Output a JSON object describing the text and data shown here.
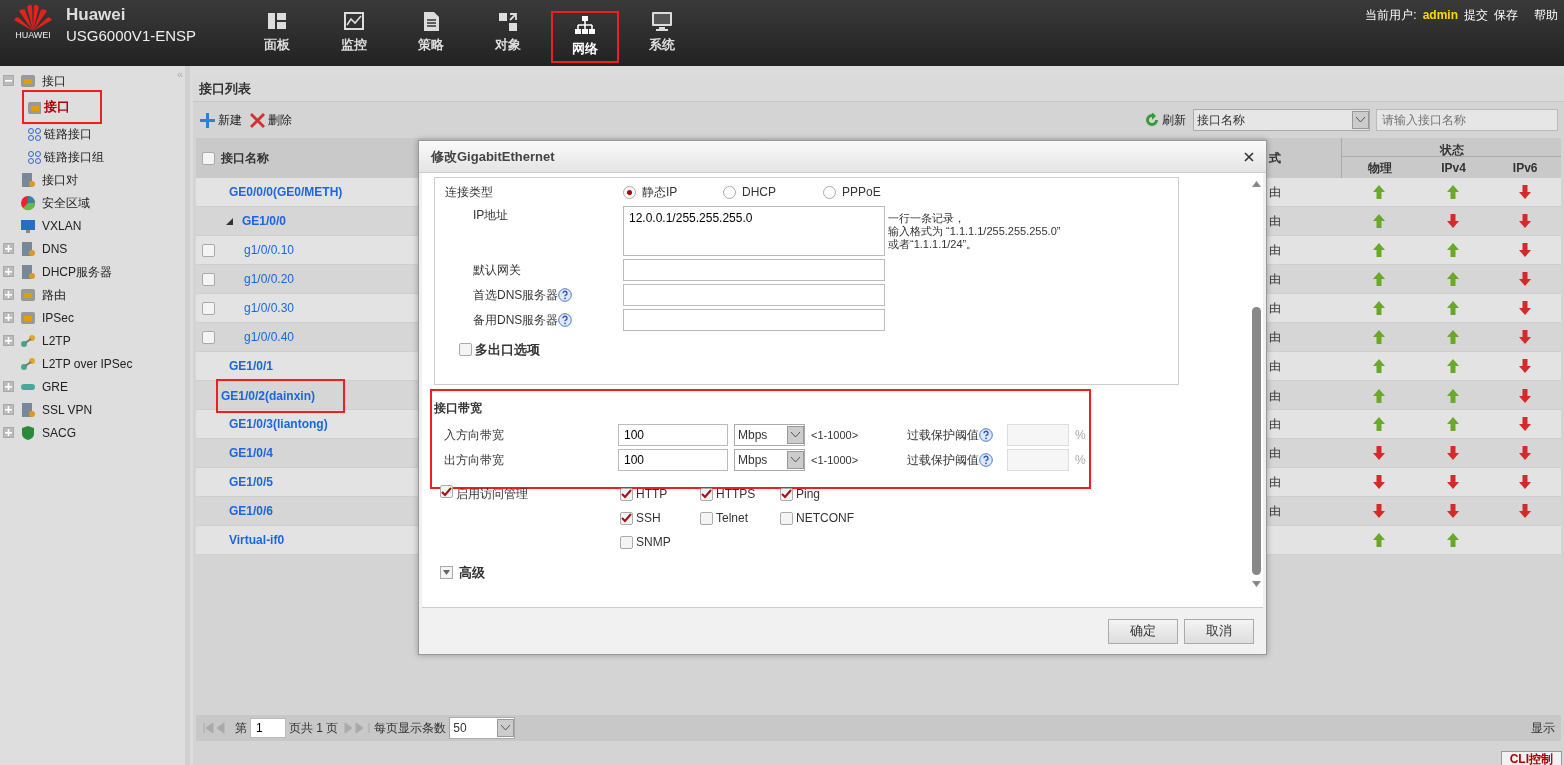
{
  "brand": {
    "company": "Huawei",
    "logo_text": "HUAWEI",
    "model": "USG6000V1-ENSP"
  },
  "nav": [
    {
      "label": "面板",
      "selected": false,
      "highlighted": false
    },
    {
      "label": "监控",
      "selected": false,
      "highlighted": false
    },
    {
      "label": "策略",
      "selected": false,
      "highlighted": false
    },
    {
      "label": "对象",
      "selected": false,
      "highlighted": false
    },
    {
      "label": "网络",
      "selected": true,
      "highlighted": true
    },
    {
      "label": "系统",
      "selected": false,
      "highlighted": false
    }
  ],
  "user_bar": {
    "label": "当前用户:",
    "user": "admin",
    "links": [
      "提交",
      "保存",
      "帮助"
    ]
  },
  "sidebar": {
    "collapse_glyph": "«",
    "items": [
      {
        "label": "接口",
        "expanded": true,
        "selected": false,
        "children": [
          {
            "label": "接口",
            "selected": true,
            "highlighted": true
          },
          {
            "label": "链路接口",
            "selected": false,
            "highlighted": false
          },
          {
            "label": "链路接口组",
            "selected": false,
            "highlighted": false
          }
        ]
      },
      {
        "label": "接口对",
        "selected": false
      },
      {
        "label": "安全区域",
        "selected": false
      },
      {
        "label": "VXLAN",
        "selected": false
      },
      {
        "label": "DNS",
        "expanded": false,
        "selected": false
      },
      {
        "label": "DHCP服务器",
        "expanded": false,
        "selected": false
      },
      {
        "label": "路由",
        "expanded": false,
        "selected": false
      },
      {
        "label": "IPSec",
        "expanded": false,
        "selected": false
      },
      {
        "label": "L2TP",
        "expanded": false,
        "selected": false
      },
      {
        "label": "L2TP over IPSec",
        "selected": false
      },
      {
        "label": "GRE",
        "expanded": false,
        "selected": false
      },
      {
        "label": "SSL VPN",
        "expanded": false,
        "selected": false
      },
      {
        "label": "SACG",
        "expanded": false,
        "selected": false
      }
    ]
  },
  "panel": {
    "title": "接口列表",
    "toolbar": [
      "新建",
      "删除"
    ],
    "refresh": "刷新",
    "filter_select": "接口名称",
    "search": {
      "placeholder": "请输入接口名称"
    }
  },
  "table": {
    "select_all": {
      "checked": false
    },
    "columns": {
      "name": "接口名称",
      "column_2": "式",
      "status": "状态",
      "physical": "物理",
      "ipv4": "IPv4",
      "ipv6": "IPv6"
    },
    "rows": [
      {
        "name": "GE0/0/0(GE0/METH)",
        "column_2": "由",
        "physical_up": true,
        "ipv4_up": true,
        "ipv6_up": false,
        "highlighted": false
      },
      {
        "name": "GE1/0/0",
        "column_2": "由",
        "physical_up": true,
        "ipv4_up": false,
        "ipv6_up": false,
        "highlighted": false,
        "expanded": true,
        "children": [
          {
            "name": "g1/0/0.10",
            "checked": false,
            "column_2": "由",
            "physical_up": true,
            "ipv4_up": true,
            "ipv6_up": false,
            "highlighted": false
          },
          {
            "name": "g1/0/0.20",
            "checked": false,
            "column_2": "由",
            "physical_up": true,
            "ipv4_up": true,
            "ipv6_up": false,
            "highlighted": false
          },
          {
            "name": "g1/0/0.30",
            "checked": false,
            "column_2": "由",
            "physical_up": true,
            "ipv4_up": true,
            "ipv6_up": false,
            "highlighted": false
          },
          {
            "name": "g1/0/0.40",
            "checked": false,
            "column_2": "由",
            "physical_up": true,
            "ipv4_up": true,
            "ipv6_up": false,
            "highlighted": false
          }
        ]
      },
      {
        "name": "GE1/0/1",
        "column_2": "由",
        "physical_up": true,
        "ipv4_up": true,
        "ipv6_up": false,
        "highlighted": false
      },
      {
        "name": "GE1/0/2(dainxin)",
        "column_2": "由",
        "physical_up": true,
        "ipv4_up": true,
        "ipv6_up": false,
        "highlighted": true
      },
      {
        "name": "GE1/0/3(liantong)",
        "column_2": "由",
        "physical_up": true,
        "ipv4_up": true,
        "ipv6_up": false,
        "highlighted": false
      },
      {
        "name": "GE1/0/4",
        "column_2": "由",
        "physical_up": false,
        "ipv4_up": false,
        "ipv6_up": false,
        "highlighted": false
      },
      {
        "name": "GE1/0/5",
        "column_2": "由",
        "physical_up": false,
        "ipv4_up": false,
        "ipv6_up": false,
        "highlighted": false
      },
      {
        "name": "GE1/0/6",
        "column_2": "由",
        "physical_up": false,
        "ipv4_up": false,
        "ipv6_up": false,
        "highlighted": false
      },
      {
        "name": "Virtual-if0",
        "physical_up": true,
        "ipv4_up": true,
        "highlighted": false
      }
    ]
  },
  "pager": {
    "page_prefix": "第",
    "page": "1",
    "page_suffix": "页共 1 页",
    "per_page_label": "每页显示条数",
    "per_page": "50",
    "right_text": "显示"
  },
  "footer": {
    "cli": "CLI控制"
  },
  "dialog": {
    "title": "修改GigabitEthernet",
    "connection": {
      "label": "连接类型",
      "options": [
        {
          "label": "静态IP",
          "selected": true
        },
        {
          "label": "DHCP",
          "selected": false
        },
        {
          "label": "PPPoE",
          "selected": false
        }
      ]
    },
    "ip": {
      "label": "IP地址",
      "value": "12.0.0.1/255.255.255.0",
      "hint": [
        "一行一条记录，",
        "输入格式为 “1.1.1.1/255.255.255.0”",
        "或者“1.1.1.1/24”。"
      ]
    },
    "fields": [
      {
        "label": "默认网关",
        "help": false
      },
      {
        "label": "首选DNS服务器",
        "help": true
      },
      {
        "label": "备用DNS服务器",
        "help": true
      }
    ],
    "multi_exit": {
      "label": "多出口选项",
      "checked": false
    },
    "bandwidth": {
      "title": "接口带宽",
      "highlighted": true,
      "rows": [
        {
          "label": "入方向带宽",
          "value": "100",
          "unit": "Mbps",
          "range": "<1-1000>",
          "threshold_label": "过载保护阈值",
          "percent": "%"
        },
        {
          "label": "出方向带宽",
          "value": "100",
          "unit": "Mbps",
          "range": "<1-1000>",
          "threshold_label": "过载保护阈值",
          "percent": "%"
        }
      ]
    },
    "access": {
      "label": "启用访问管理",
      "checked": true,
      "services": [
        {
          "label": "HTTP",
          "checked": true
        },
        {
          "label": "HTTPS",
          "checked": true
        },
        {
          "label": "Ping",
          "checked": true
        },
        {
          "label": "SSH",
          "checked": true
        },
        {
          "label": "Telnet",
          "checked": false
        },
        {
          "label": "NETCONF",
          "checked": false
        },
        {
          "label": "SNMP",
          "checked": false
        }
      ]
    },
    "advanced": {
      "label": "高级",
      "expanded": false
    },
    "buttons": [
      "确定",
      "取消"
    ]
  }
}
